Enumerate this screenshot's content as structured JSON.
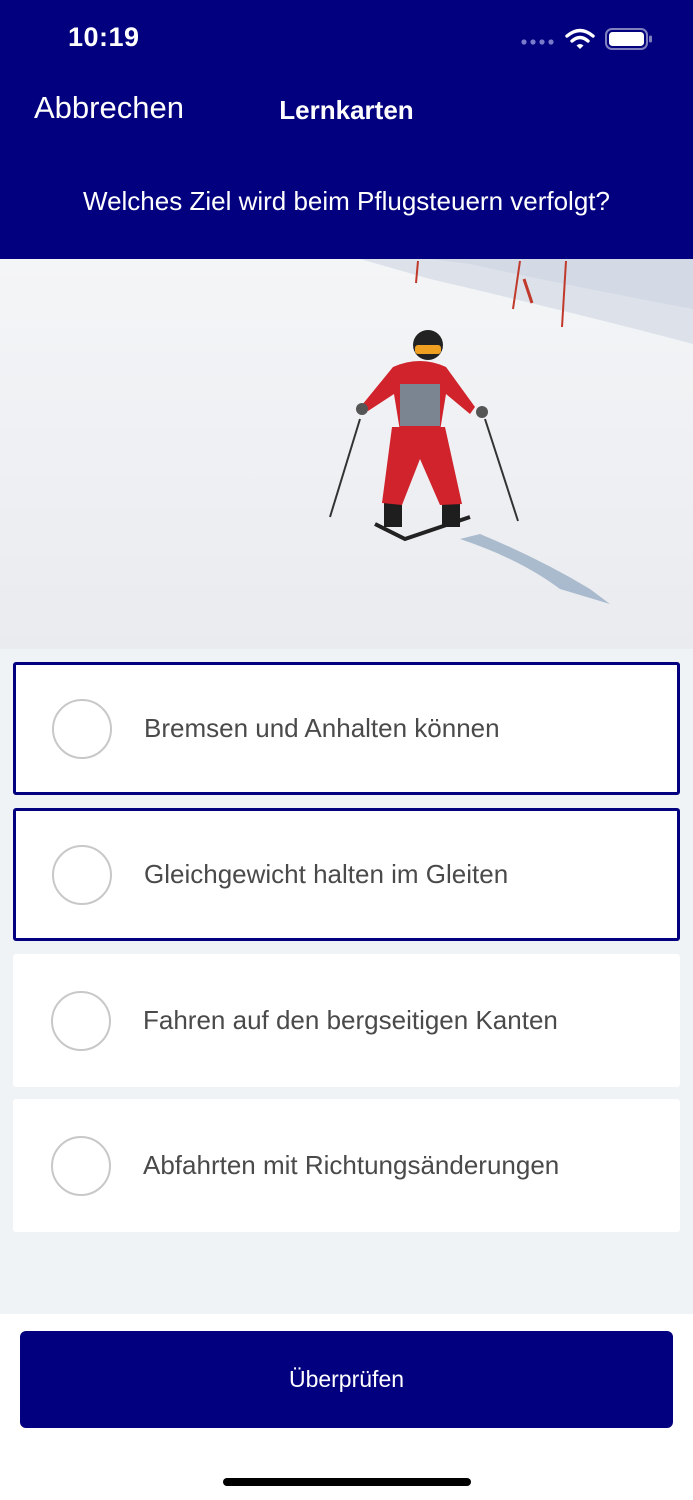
{
  "status_bar": {
    "time": "10:19"
  },
  "nav": {
    "cancel_label": "Abbrechen",
    "title": "Lernkarten"
  },
  "question": "Welches Ziel wird beim Pflugsteuern verfolgt?",
  "image": {
    "alt": "skier-snowplow-photo"
  },
  "options": [
    {
      "label": "Bremsen und Anhalten können",
      "selected": true
    },
    {
      "label": "Gleichgewicht halten im Gleiten",
      "selected": true
    },
    {
      "label": "Fahren auf den bergseitigen Kanten",
      "selected": false
    },
    {
      "label": "Abfahrten mit Richtungsänderungen",
      "selected": false
    }
  ],
  "footer": {
    "check_label": "Überprüfen"
  },
  "colors": {
    "brand": "#02007e",
    "background": "#f0f3f6"
  },
  "icons": [
    "signal-icon",
    "wifi-icon",
    "battery-icon",
    "radio-icon"
  ]
}
